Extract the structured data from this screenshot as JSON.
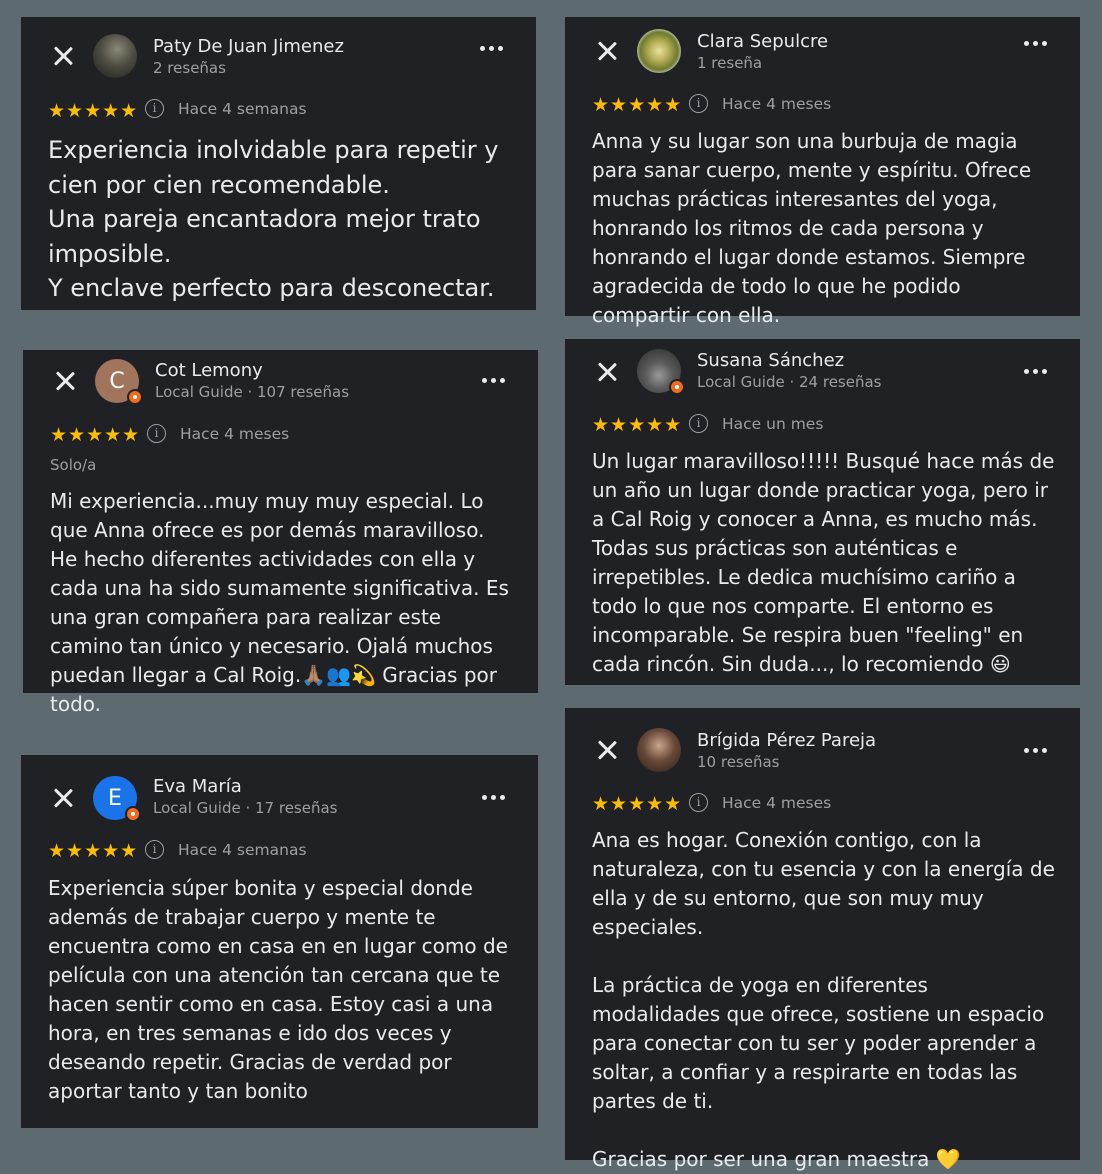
{
  "reviews": [
    {
      "name": "Paty De Juan Jimenez",
      "meta": "2 reseñas",
      "stars": "★★★★★",
      "time": "Hace 4 semanas",
      "text": "Experiencia inolvidable para repetir y cien por cien recomendable.\nUna pareja encantadora mejor trato imposible.\nY enclave perfecto para desconectar."
    },
    {
      "name": "Clara Sepulcre",
      "meta": "1 reseña",
      "stars": "★★★★★",
      "time": "Hace 4 meses",
      "text": "Anna y su lugar son una burbuja de magia para sanar cuerpo, mente y espíritu. Ofrece muchas prácticas interesantes del yoga, honrando los ritmos de cada persona y honrando el lugar donde estamos. Siempre agradecida de todo lo que he podido compartir con ella."
    },
    {
      "name": "Cot Lemony",
      "meta": "Local Guide · 107 reseñas",
      "avatar_letter": "C",
      "stars": "★★★★★",
      "time": "Hace 4 meses",
      "tag": "Solo/a",
      "text": "Mi experiencia...muy muy muy especial. Lo que Anna ofrece es por demás maravilloso. He hecho diferentes actividades con ella y cada una ha sido sumamente significativa. Es una gran compañera para realizar este camino tan único y necesario. Ojalá muchos puedan llegar a Cal Roig.🙏🏽👥💫 Gracias por todo."
    },
    {
      "name": "Susana Sánchez",
      "meta": "Local Guide · 24 reseñas",
      "stars": "★★★★★",
      "time": "Hace un mes",
      "text": "Un lugar maravilloso!!!!! Busqué hace más de un año un lugar donde practicar yoga, pero ir a Cal Roig y conocer a Anna, es mucho más. Todas sus prácticas son auténticas e irrepetibles. Le dedica muchísimo cariño a todo lo que nos comparte. El entorno es incomparable. Se respira buen \"feeling\" en cada rincón. Sin duda..., lo recomiendo 😃"
    },
    {
      "name": "Eva María",
      "meta": "Local Guide · 17 reseñas",
      "avatar_letter": "E",
      "stars": "★★★★★",
      "time": "Hace 4 semanas",
      "text": "Experiencia súper bonita y especial donde además de trabajar cuerpo y mente te encuentra como en casa en en lugar como de película con una atención tan cercana que te hacen sentir como en casa. Estoy casi a una hora, en tres semanas e ido dos veces y deseando repetir. Gracias de verdad por aportar tanto y tan bonito"
    },
    {
      "name": "Brígida Pérez Pareja",
      "meta": "10 reseñas",
      "stars": "★★★★★",
      "time": "Hace 4 meses",
      "text": "Ana es hogar. Conexión contigo, con la naturaleza, con tu esencia y con la energía de ella y de su entorno, que son muy muy especiales.\n\nLa práctica de yoga en diferentes modalidades que ofrece, sostiene un espacio para conectar con tu ser y poder aprender a soltar, a confiar y a respirarte en todas las partes de ti.\n\nGracias por ser una gran maestra 💛"
    }
  ]
}
